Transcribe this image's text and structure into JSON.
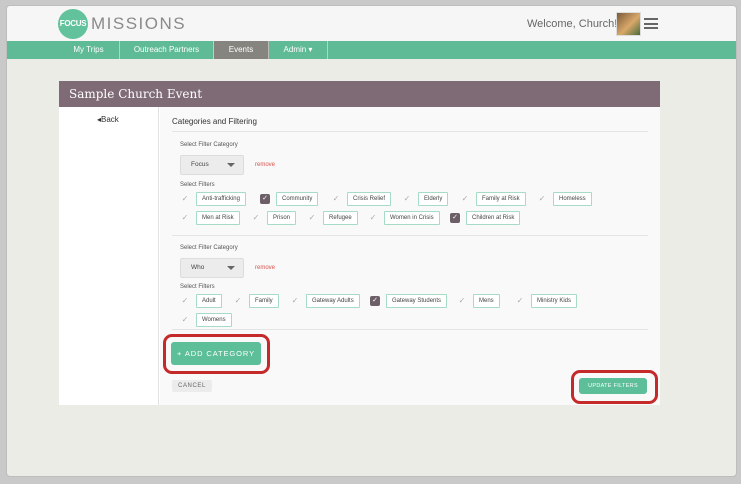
{
  "header": {
    "logo_text": "FOCUS",
    "brand": "MISSIONS",
    "welcome": "Welcome, Church!"
  },
  "nav": {
    "items": [
      {
        "label": "My Trips",
        "active": false
      },
      {
        "label": "Outreach Partners",
        "active": false
      },
      {
        "label": "Events",
        "active": true
      },
      {
        "label": "Admin ▾",
        "active": false
      }
    ]
  },
  "page": {
    "title": "Sample Church Event",
    "back_label": "◂Back",
    "section_title": "Categories and Filtering"
  },
  "groups": [
    {
      "category_label": "Select Filter Category",
      "category_value": "Focus",
      "remove_label": "remove",
      "filters_label": "Select Filters",
      "filters": [
        {
          "label": "Anti-trafficking",
          "checked": false
        },
        {
          "label": "Community",
          "checked": true
        },
        {
          "label": "Crisis Relief",
          "checked": false
        },
        {
          "label": "Elderly",
          "checked": false
        },
        {
          "label": "Family at Risk",
          "checked": false
        },
        {
          "label": "Homeless",
          "checked": false
        },
        {
          "label": "Men at Risk",
          "checked": false
        },
        {
          "label": "Prison",
          "checked": false
        },
        {
          "label": "Refugee",
          "checked": false
        },
        {
          "label": "Women in Crisis",
          "checked": false
        },
        {
          "label": "Children at Risk",
          "checked": true
        }
      ]
    },
    {
      "category_label": "Select Filter Category",
      "category_value": "Who",
      "remove_label": "remove",
      "filters_label": "Select Filters",
      "filters": [
        {
          "label": "Adult",
          "checked": false
        },
        {
          "label": "Family",
          "checked": false
        },
        {
          "label": "Gateway Adults",
          "checked": false
        },
        {
          "label": "Gateway Students",
          "checked": true
        },
        {
          "label": "Mens",
          "checked": false
        },
        {
          "label": "Ministry Kids",
          "checked": false
        },
        {
          "label": "Womens",
          "checked": false
        }
      ]
    }
  ],
  "actions": {
    "add_category": "+ ADD CATEGORY",
    "cancel": "CANCEL",
    "update_filters": "UPDATE FILTERS"
  },
  "colors": {
    "brand_green": "#5fba96",
    "header_mauve": "#7f6b75",
    "highlight_red": "#c42a2a"
  }
}
